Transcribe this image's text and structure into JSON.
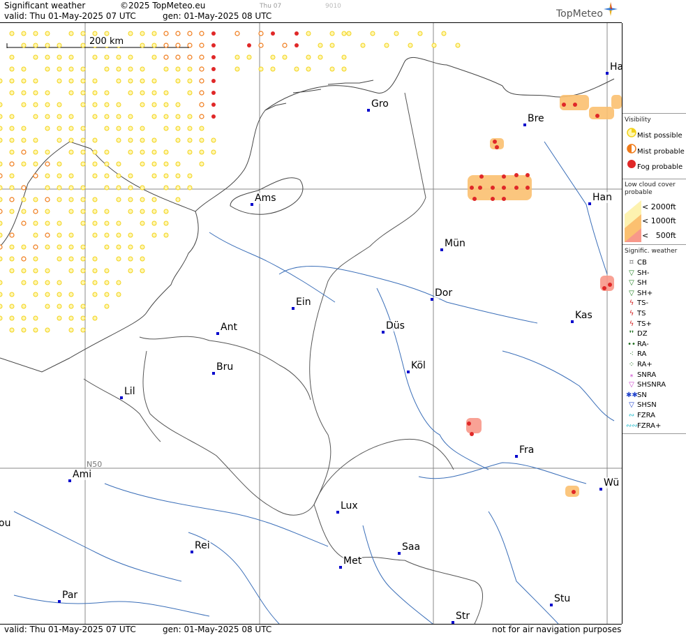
{
  "header": {
    "title": "Significant weather",
    "copyright": "©2025 TopMeteo.eu",
    "valid": "valid:  Thu  01-May-2025  07 UTC",
    "generated": "gen: 01-May-2025 08 UTC",
    "day_label": "Thu 07",
    "code": "9010",
    "brand": "TopMeteo"
  },
  "footer": {
    "valid": "valid:  Thu  01-May-2025  07 UTC",
    "generated": "gen: 01-May-2025 08 UTC",
    "disclaimer": "not for air navigation purposes"
  },
  "map": {
    "scale_label": "200 km",
    "grid_label": "N50",
    "cities": [
      {
        "name": "Gro"
      },
      {
        "name": "Bre"
      },
      {
        "name": "Ha"
      },
      {
        "name": "Ams"
      },
      {
        "name": "Han"
      },
      {
        "name": "Mün"
      },
      {
        "name": "Dor"
      },
      {
        "name": "Ein"
      },
      {
        "name": "Düs"
      },
      {
        "name": "Ant"
      },
      {
        "name": "Kas"
      },
      {
        "name": "Bru"
      },
      {
        "name": "Köl"
      },
      {
        "name": "Lil"
      },
      {
        "name": "Fra"
      },
      {
        "name": "Ami"
      },
      {
        "name": "Wü"
      },
      {
        "name": "Lux"
      },
      {
        "name": "ou"
      },
      {
        "name": "Rei"
      },
      {
        "name": "Saa"
      },
      {
        "name": "Met"
      },
      {
        "name": "Stu"
      },
      {
        "name": "Par"
      },
      {
        "name": "Str"
      }
    ]
  },
  "legend": {
    "visibility": {
      "title": "Visibility",
      "items": [
        {
          "label": "Mist possible",
          "color": "#f2d21a"
        },
        {
          "label": "Mist probable",
          "color": "#f07a18"
        },
        {
          "label": "Fog probable",
          "color": "#e02828"
        }
      ]
    },
    "low_cloud": {
      "title": "Low cloud cover probable",
      "items": [
        {
          "label": "< 2000ft",
          "color": "#fdf2b0"
        },
        {
          "label": "< 1000ft",
          "color": "#fbc070"
        },
        {
          "label": "<   500ft",
          "color": "#f8988a"
        }
      ]
    },
    "weather": {
      "title": "Signific. weather",
      "items": [
        {
          "label": "CB",
          "icon": "cb-icon",
          "glyph": "⌑",
          "color": "#333333"
        },
        {
          "label": "SH-",
          "icon": "shower-light-icon",
          "glyph": "▽",
          "color": "#208020"
        },
        {
          "label": "SH",
          "icon": "shower-icon",
          "glyph": "▽",
          "color": "#208020"
        },
        {
          "label": "SH+",
          "icon": "shower-heavy-icon",
          "glyph": "▽",
          "color": "#208020"
        },
        {
          "label": "TS-",
          "icon": "thunderstorm-light-icon",
          "glyph": "ϟ",
          "color": "#d02020"
        },
        {
          "label": "TS",
          "icon": "thunderstorm-icon",
          "glyph": "ϟ",
          "color": "#d02020"
        },
        {
          "label": "TS+",
          "icon": "thunderstorm-heavy-icon",
          "glyph": "ϟ",
          "color": "#d02020"
        },
        {
          "label": "DZ",
          "icon": "drizzle-icon",
          "glyph": "❜❜",
          "color": "#1a6a1a"
        },
        {
          "label": "RA-",
          "icon": "rain-light-icon",
          "glyph": "••",
          "color": "#1a6a1a"
        },
        {
          "label": "RA",
          "icon": "rain-icon",
          "glyph": "⁖",
          "color": "#1a6a1a"
        },
        {
          "label": "RA+",
          "icon": "rain-heavy-icon",
          "glyph": "⁘",
          "color": "#1a6a1a"
        },
        {
          "label": "SNRA",
          "icon": "snow-rain-icon",
          "glyph": "⁎",
          "color": "#cc44cc"
        },
        {
          "label": "SHSNRA",
          "icon": "snow-rain-shower-icon",
          "glyph": "▽",
          "color": "#cc44cc"
        },
        {
          "label": "SN",
          "icon": "snow-icon",
          "glyph": "✱✱",
          "color": "#2244cc"
        },
        {
          "label": "SHSN",
          "icon": "snow-shower-icon",
          "glyph": "▽",
          "color": "#2244cc"
        },
        {
          "label": "FZRA",
          "icon": "freezing-rain-icon",
          "glyph": "∾",
          "color": "#22bbcc"
        },
        {
          "label": "FZRA+",
          "icon": "freezing-rain-heavy-icon",
          "glyph": "∾∾",
          "color": "#22bbcc"
        }
      ]
    }
  }
}
